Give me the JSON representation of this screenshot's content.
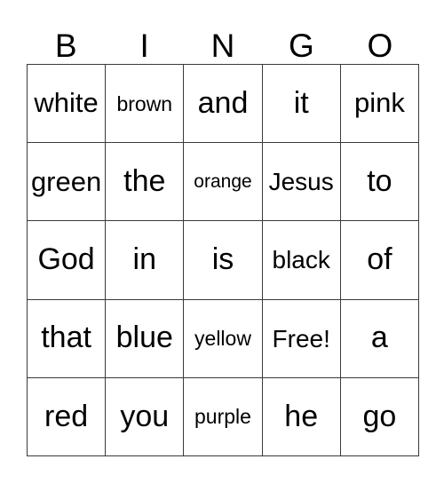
{
  "header": {
    "letters": [
      "B",
      "I",
      "N",
      "G",
      "O"
    ]
  },
  "grid": {
    "rows": [
      {
        "cells": [
          {
            "text": "white",
            "size": "fs-lg"
          },
          {
            "text": "brown",
            "size": "fs-sm"
          },
          {
            "text": "and",
            "size": "fs-xl"
          },
          {
            "text": "it",
            "size": "fs-xl"
          },
          {
            "text": "pink",
            "size": "fs-lg"
          }
        ]
      },
      {
        "cells": [
          {
            "text": "green",
            "size": "fs-lg"
          },
          {
            "text": "the",
            "size": "fs-xl"
          },
          {
            "text": "orange",
            "size": "fs-xs"
          },
          {
            "text": "Jesus",
            "size": "fs-md"
          },
          {
            "text": "to",
            "size": "fs-xl"
          }
        ]
      },
      {
        "cells": [
          {
            "text": "God",
            "size": "fs-xl"
          },
          {
            "text": "in",
            "size": "fs-xl"
          },
          {
            "text": "is",
            "size": "fs-xl"
          },
          {
            "text": "black",
            "size": "fs-md"
          },
          {
            "text": "of",
            "size": "fs-xl"
          }
        ]
      },
      {
        "cells": [
          {
            "text": "that",
            "size": "fs-xl"
          },
          {
            "text": "blue",
            "size": "fs-xl"
          },
          {
            "text": "yellow",
            "size": "fs-sm"
          },
          {
            "text": "Free!",
            "size": "fs-md"
          },
          {
            "text": "a",
            "size": "fs-xl"
          }
        ]
      },
      {
        "cells": [
          {
            "text": "red",
            "size": "fs-xl"
          },
          {
            "text": "you",
            "size": "fs-xl"
          },
          {
            "text": "purple",
            "size": "fs-sm"
          },
          {
            "text": "he",
            "size": "fs-xl"
          },
          {
            "text": "go",
            "size": "fs-xl"
          }
        ]
      }
    ]
  },
  "colors": {
    "background": "#ffffff",
    "text": "#000000",
    "gridline": "#3a3a3a"
  }
}
